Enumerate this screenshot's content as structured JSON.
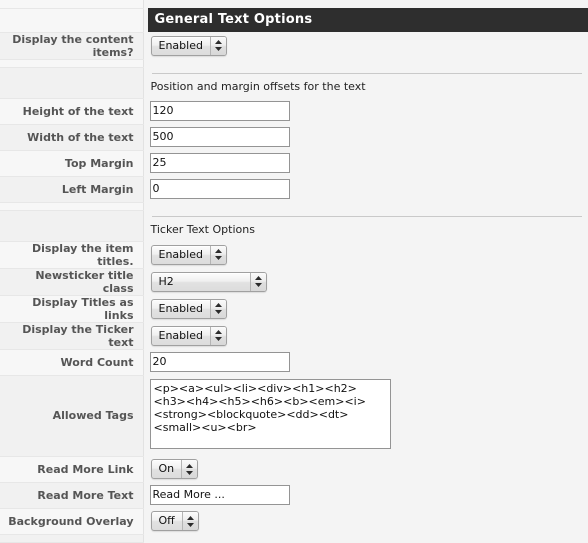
{
  "panel": {
    "header_title": "General Text Options"
  },
  "sections": {
    "position_caption": "Position and margin offsets for the text",
    "ticker_caption": "Ticker Text Options"
  },
  "fields": {
    "display_content_items": {
      "label": "Display the content items?",
      "value": "Enabled"
    },
    "height_of_text": {
      "label": "Height of the text",
      "value": "120"
    },
    "width_of_text": {
      "label": "Width of the text",
      "value": "500"
    },
    "top_margin": {
      "label": "Top Margin",
      "value": "25"
    },
    "left_margin": {
      "label": "Left Margin",
      "value": "0"
    },
    "display_item_titles": {
      "label": "Display the item titles.",
      "value": "Enabled"
    },
    "newsticker_title_class": {
      "label": "Newsticker title class",
      "value": "H2"
    },
    "display_titles_as_links": {
      "label": "Display Titles as links",
      "value": "Enabled"
    },
    "display_ticker_text": {
      "label": "Display the Ticker text",
      "value": "Enabled"
    },
    "word_count": {
      "label": "Word Count",
      "value": "20"
    },
    "allowed_tags": {
      "label": "Allowed Tags",
      "value": "<p><a><ul><li><div><h1><h2><h3><h4><h5><h6><b><em><i><strong><blockquote><dd><dt><small><u><br>"
    },
    "read_more_link": {
      "label": "Read More Link",
      "value": "On"
    },
    "read_more_text": {
      "label": "Read More Text",
      "value": "Read More ..."
    },
    "background_overlay": {
      "label": "Background Overlay",
      "value": "Off"
    }
  },
  "icons": {
    "stepper": "up-down-arrows-icon"
  },
  "colors": {
    "header_bg": "#2e2e2e",
    "header_text": "#ffffff",
    "page_bg": "#f4f4f4",
    "label_text": "#555555",
    "row_divider": "#e7e7e7"
  }
}
